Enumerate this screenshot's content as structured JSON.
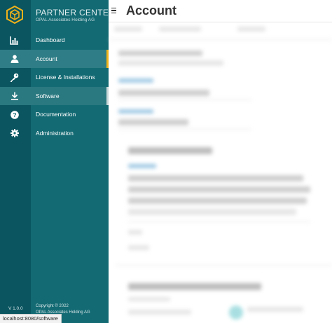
{
  "app": {
    "brand_title": "PARTNER CENTER",
    "brand_subtitle": "OPAL Associates Holding AG",
    "version": "V 1.0.0",
    "copyright_line1": "Copyright © 2022",
    "copyright_line2": "OPAL Associates Holding AG",
    "status_url": "localhost:8080/software"
  },
  "sidebar": {
    "items": [
      {
        "label": "Dashboard",
        "icon": "bar-chart-icon",
        "state": "normal"
      },
      {
        "label": "Account",
        "icon": "user-icon",
        "state": "active"
      },
      {
        "label": "License & Installations",
        "icon": "key-icon",
        "state": "normal"
      },
      {
        "label": "Software",
        "icon": "download-icon",
        "state": "hover"
      },
      {
        "label": "Documentation",
        "icon": "help-icon",
        "state": "normal"
      },
      {
        "label": "Administration",
        "icon": "gear-icon",
        "state": "normal"
      }
    ]
  },
  "header": {
    "title": "Account",
    "menu_icon": "hamburger-menu-icon"
  },
  "colors": {
    "rail": "#0a5560",
    "sidebar": "#136a73",
    "active_item": "#2f7d86",
    "accent": "#f1b21a",
    "logo": "#f1b21a"
  }
}
